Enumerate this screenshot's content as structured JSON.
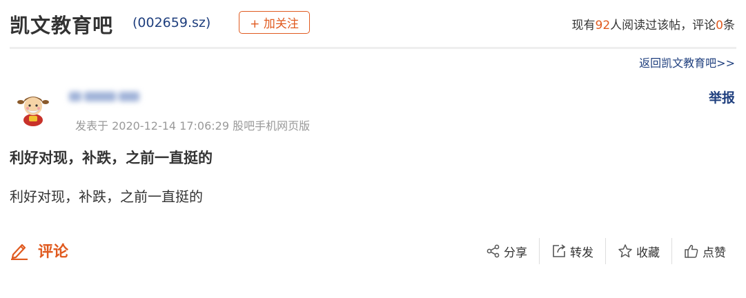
{
  "header": {
    "forum_title": "凯文教育吧",
    "stock_code": "(002659.sz)",
    "follow_label": "+ 加关注",
    "read_prefix": "现有",
    "read_count": "92",
    "read_middle": "人阅读过该帖，评论",
    "comment_count": "0",
    "read_suffix": "条"
  },
  "nav": {
    "back_link": "返回凯文教育吧>>"
  },
  "post": {
    "report_label": "举报",
    "meta": "发表于 2020-12-14 17:06:29 股吧手机网页版",
    "title": "利好对现，补跌，之前一直挺的",
    "body": "利好对现，补跌，之前一直挺的"
  },
  "footer": {
    "comment_label": "评论",
    "actions": [
      {
        "label": "分享",
        "icon": "share-icon"
      },
      {
        "label": "转发",
        "icon": "forward-icon"
      },
      {
        "label": "收藏",
        "icon": "star-icon"
      },
      {
        "label": "点赞",
        "icon": "thumbs-up-icon"
      }
    ]
  },
  "colors": {
    "accent": "#e05a1f",
    "link": "#1f3f7e",
    "muted": "#999999",
    "text": "#333333"
  }
}
